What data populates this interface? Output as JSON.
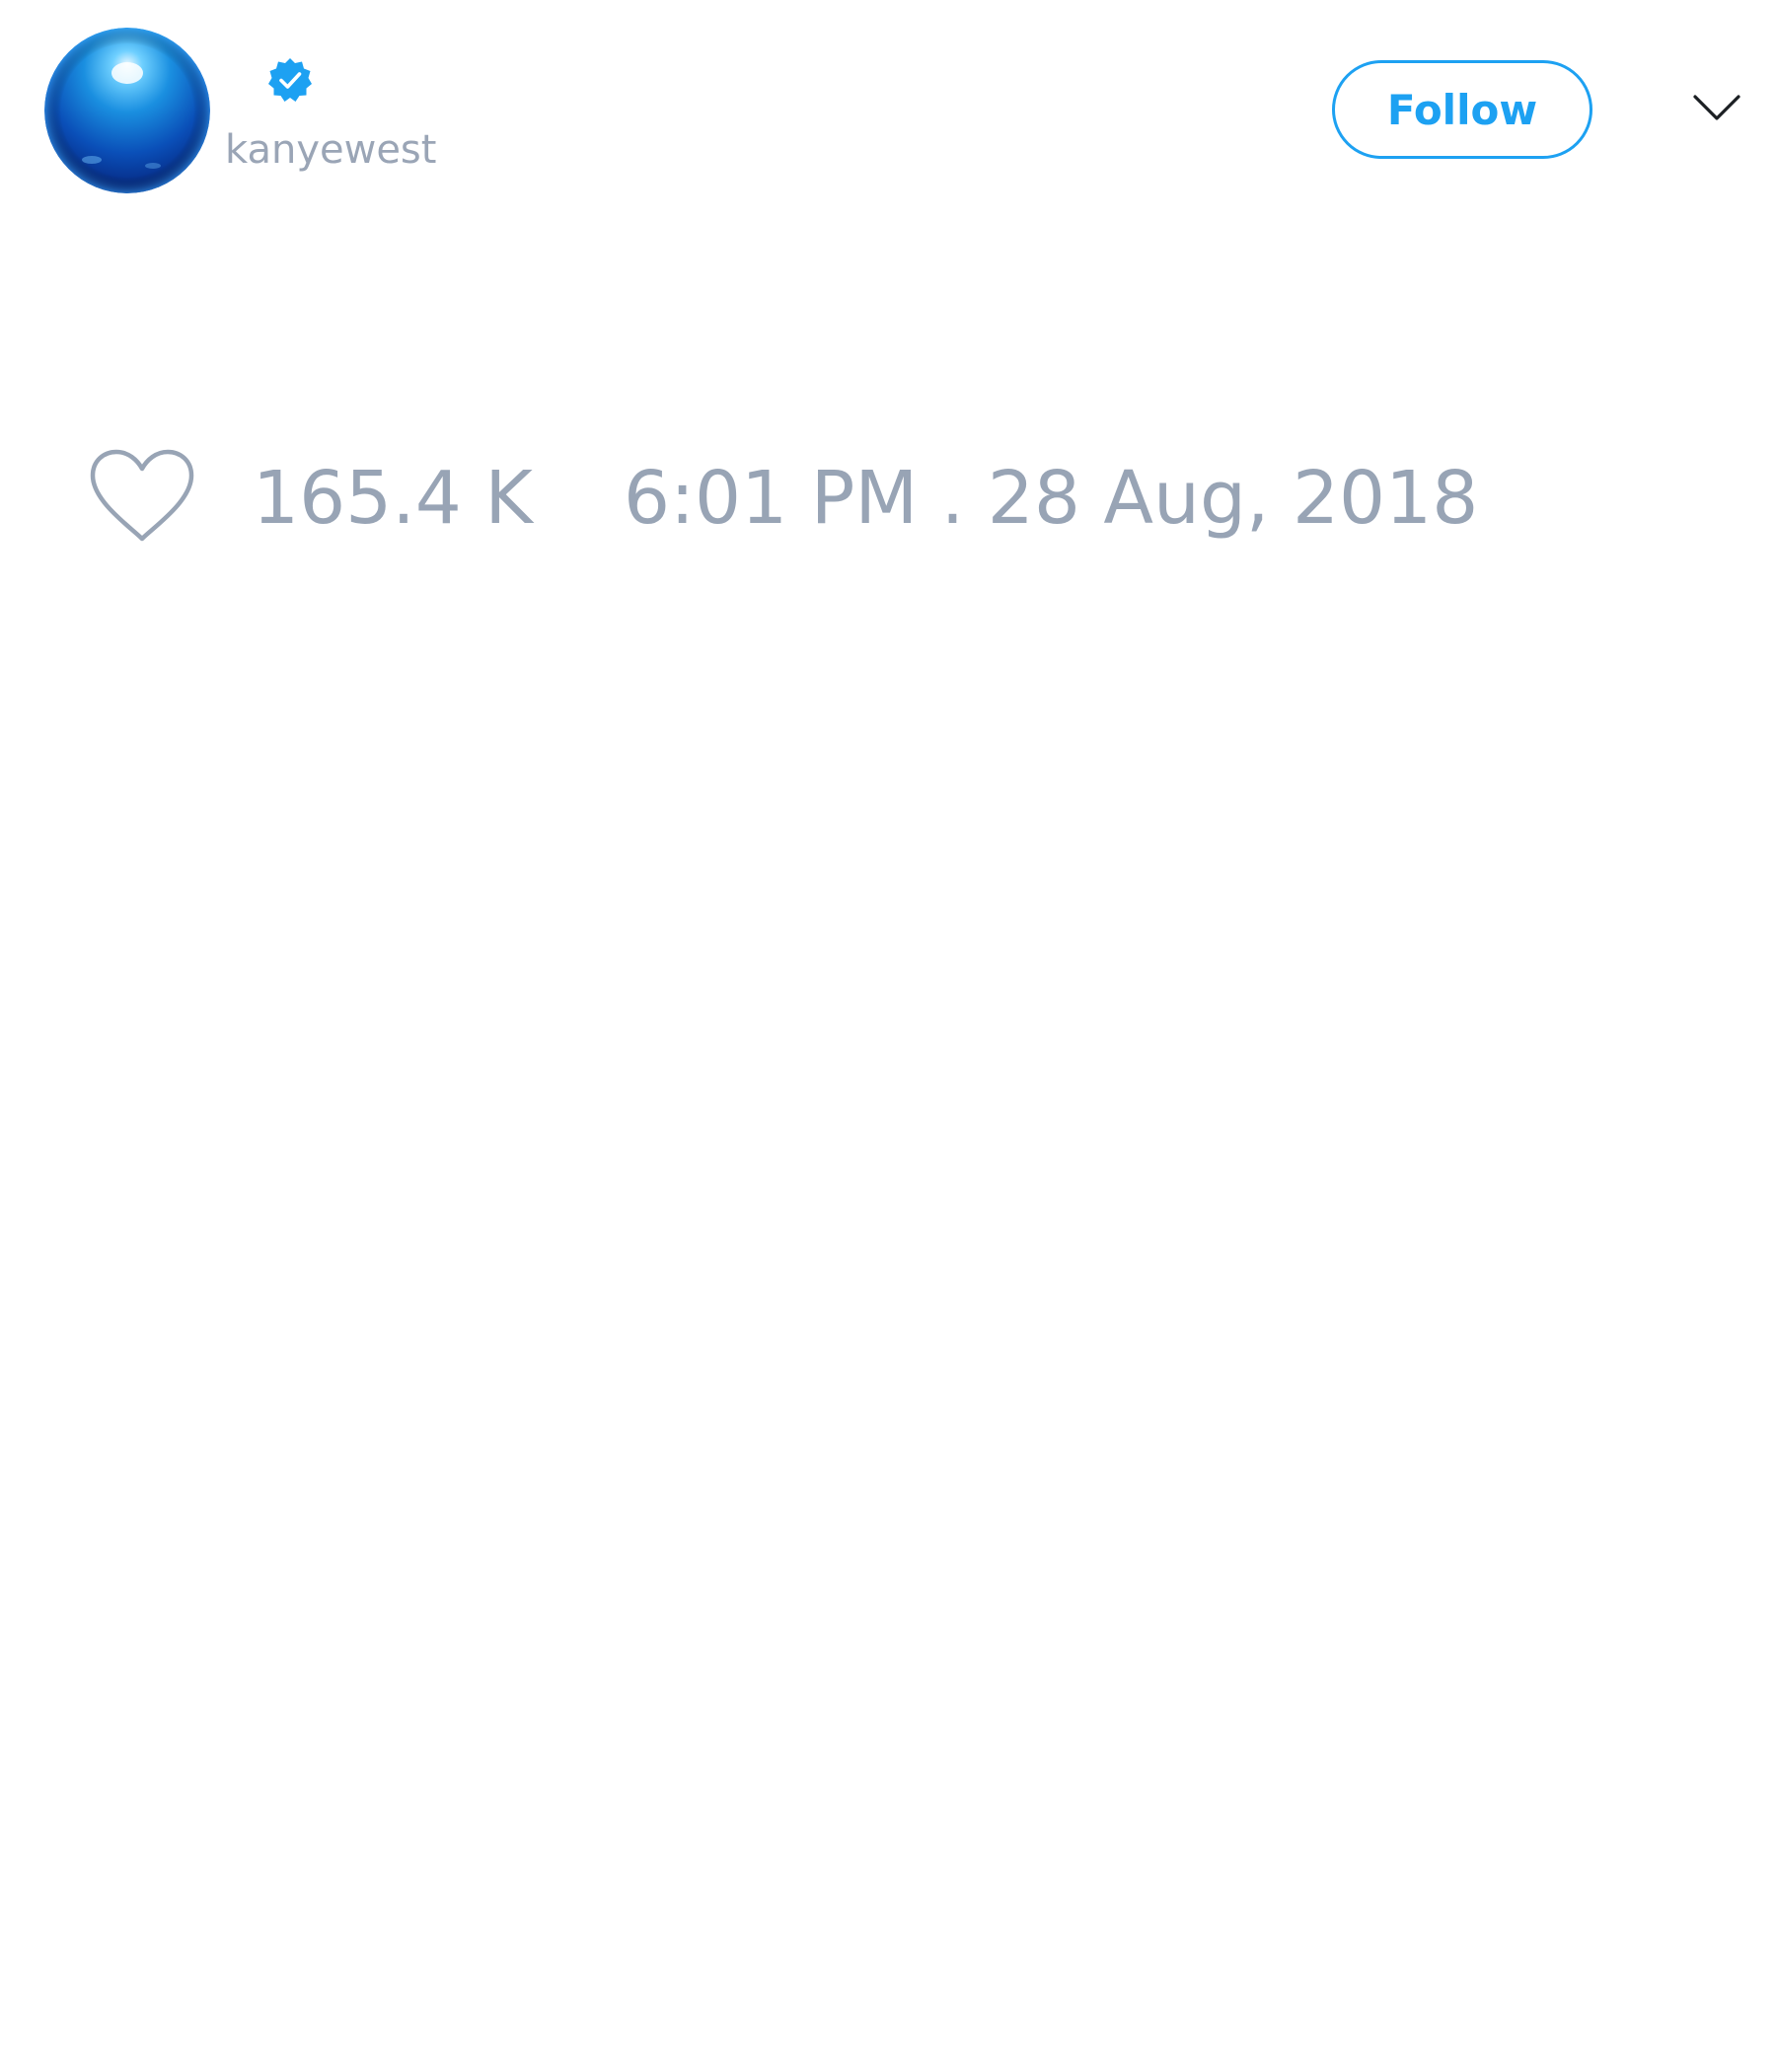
{
  "tweet_header": {
    "avatar_icon": "blue-sphere-avatar",
    "verified_icon": "verified-badge-icon",
    "handle": "kanyewest",
    "follow_label": "Follow",
    "menu_icon": "chevron-down-icon"
  },
  "tweet_stats": {
    "like_icon": "heart-outline-icon",
    "like_count": "165.4 K",
    "timestamp": "6:01 PM . 28 Aug, 2018"
  },
  "colors": {
    "accent": "#1da1f2",
    "muted_text": "#98a4b5",
    "background": "#ffffff"
  }
}
